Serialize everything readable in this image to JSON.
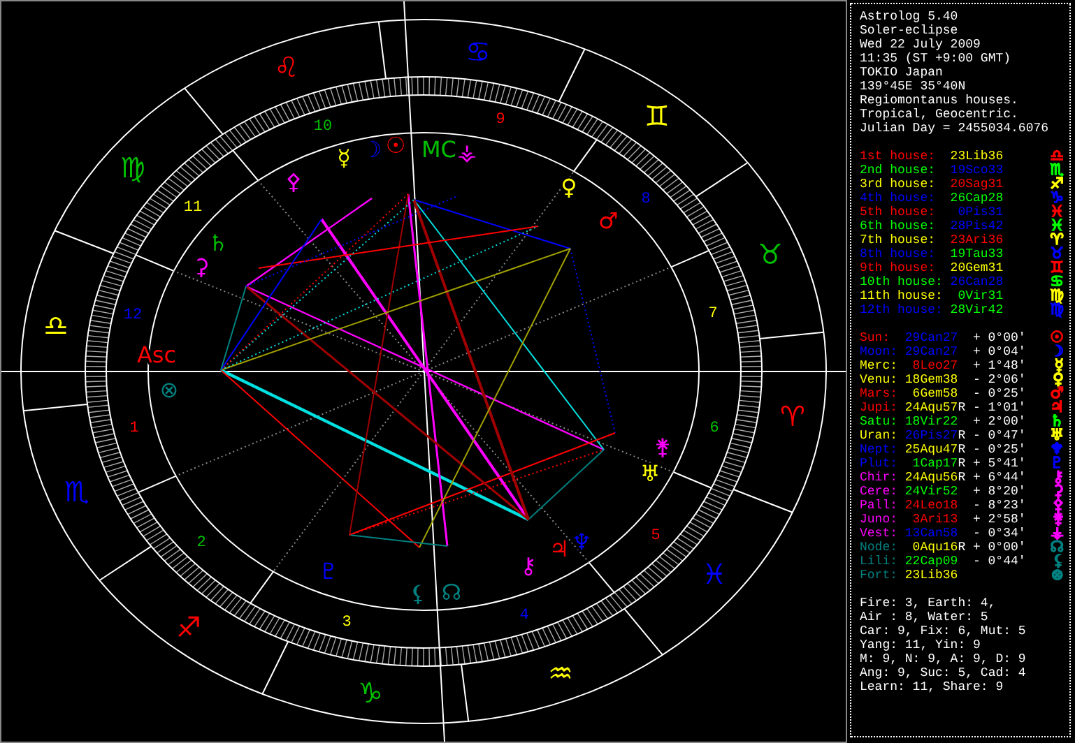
{
  "chart": {
    "signs": [
      {
        "glyph": "♎",
        "color": "#ffff00"
      },
      {
        "glyph": "♏",
        "color": "#0000ff"
      },
      {
        "glyph": "♐",
        "color": "#ff0000"
      },
      {
        "glyph": "♑",
        "color": "#00c000"
      },
      {
        "glyph": "♒",
        "color": "#ffff00"
      },
      {
        "glyph": "♓",
        "color": "#0000ff"
      },
      {
        "glyph": "♈",
        "color": "#ff0000"
      },
      {
        "glyph": "♉",
        "color": "#00c000"
      },
      {
        "glyph": "♊",
        "color": "#ffff00"
      },
      {
        "glyph": "♋",
        "color": "#0000ff"
      },
      {
        "glyph": "♌",
        "color": "#ff0000"
      },
      {
        "glyph": "♍",
        "color": "#00c000"
      }
    ],
    "house_numbers": [
      {
        "text": "1",
        "color": "#ff0000"
      },
      {
        "text": "2",
        "color": "#00c000"
      },
      {
        "text": "3",
        "color": "#ffff00"
      },
      {
        "text": "4",
        "color": "#0000ff"
      },
      {
        "text": "5",
        "color": "#ff0000"
      },
      {
        "text": "6",
        "color": "#00c000"
      },
      {
        "text": "7",
        "color": "#ffff00"
      },
      {
        "text": "8",
        "color": "#0000ff"
      },
      {
        "text": "9",
        "color": "#ff0000"
      },
      {
        "text": "10",
        "color": "#00c000"
      },
      {
        "text": "11",
        "color": "#ffff00"
      },
      {
        "text": "12",
        "color": "#0000ff"
      }
    ],
    "points": [
      {
        "glyph": "☿",
        "color": "#ffff00"
      },
      {
        "glyph": "☽",
        "color": "#0000ff"
      },
      {
        "glyph": "☉",
        "color": "#ff0000"
      },
      {
        "glyph": "MC",
        "color": "#00c000"
      },
      {
        "glyph": "⚶",
        "color": "#ff00ff"
      },
      {
        "glyph": "⚴",
        "color": "#ff00ff"
      },
      {
        "glyph": "♀",
        "color": "#ffff00"
      },
      {
        "glyph": "♂",
        "color": "#ff0000"
      },
      {
        "glyph": "♄",
        "color": "#00c000"
      },
      {
        "glyph": "⚳",
        "color": "#ff00ff"
      },
      {
        "glyph": "Asc",
        "color": "#ff0000"
      },
      {
        "glyph": "⊗",
        "color": "#008080"
      },
      {
        "glyph": "⚵",
        "color": "#ff00ff"
      },
      {
        "glyph": "♅",
        "color": "#ffff00"
      },
      {
        "glyph": "♆",
        "color": "#0000ff"
      },
      {
        "glyph": "♃",
        "color": "#ff0000"
      },
      {
        "glyph": "⚷",
        "color": "#ff00ff"
      },
      {
        "glyph": "☊",
        "color": "#008080"
      },
      {
        "glyph": "⚸",
        "color": "#008080"
      },
      {
        "glyph": "♇",
        "color": "#0000ff"
      }
    ]
  },
  "info": [
    "Astrolog 5.40",
    "Soler-eclipse",
    "Wed 22 July 2009",
    "11:35 (ST +9:00 GMT)",
    "TOKIO Japan",
    "139°45E 35°40N",
    "Regiomontanus houses.",
    "Tropical, Geocentric.",
    "Julian Day = 2455034.6076"
  ],
  "houses": [
    {
      "label": {
        "text": "1st house:",
        "color": "#ff0000"
      },
      "cusp": {
        "text": "23Lib36",
        "color": "#ffff00"
      },
      "glyph": {
        "text": "♎",
        "color": "#ff0000"
      }
    },
    {
      "label": {
        "text": "2nd house:",
        "color": "#00ff00"
      },
      "cusp": {
        "text": "19Sco33",
        "color": "#0000ff"
      },
      "glyph": {
        "text": "♏",
        "color": "#00ff00"
      }
    },
    {
      "label": {
        "text": "3rd house:",
        "color": "#ffff00"
      },
      "cusp": {
        "text": "20Sag31",
        "color": "#ff0000"
      },
      "glyph": {
        "text": "♐",
        "color": "#ffff00"
      }
    },
    {
      "label": {
        "text": "4th house:",
        "color": "#0000ff"
      },
      "cusp": {
        "text": "26Cap28",
        "color": "#00ff00"
      },
      "glyph": {
        "text": "♑",
        "color": "#0000ff"
      }
    },
    {
      "label": {
        "text": "5th house:",
        "color": "#ff0000"
      },
      "cusp": {
        "text": "0Pis31",
        "color": "#0000ff"
      },
      "glyph": {
        "text": "♓",
        "color": "#ff0000"
      }
    },
    {
      "label": {
        "text": "6th house:",
        "color": "#00ff00"
      },
      "cusp": {
        "text": "28Pis42",
        "color": "#0000ff"
      },
      "glyph": {
        "text": "♓",
        "color": "#00ff00"
      }
    },
    {
      "label": {
        "text": "7th house:",
        "color": "#ffff00"
      },
      "cusp": {
        "text": "23Ari36",
        "color": "#ff0000"
      },
      "glyph": {
        "text": "♈",
        "color": "#ffff00"
      }
    },
    {
      "label": {
        "text": "8th house:",
        "color": "#0000ff"
      },
      "cusp": {
        "text": "19Tau33",
        "color": "#00ff00"
      },
      "glyph": {
        "text": "♉",
        "color": "#0000ff"
      }
    },
    {
      "label": {
        "text": "9th house:",
        "color": "#ff0000"
      },
      "cusp": {
        "text": "20Gem31",
        "color": "#ffff00"
      },
      "glyph": {
        "text": "♊",
        "color": "#ff0000"
      }
    },
    {
      "label": {
        "text": "10th house:",
        "color": "#00ff00"
      },
      "cusp": {
        "text": "26Can28",
        "color": "#0000ff"
      },
      "glyph": {
        "text": "♋",
        "color": "#00ff00"
      }
    },
    {
      "label": {
        "text": "11th house:",
        "color": "#ffff00"
      },
      "cusp": {
        "text": "0Vir31",
        "color": "#00ff00"
      },
      "glyph": {
        "text": "♍",
        "color": "#ffff00"
      }
    },
    {
      "label": {
        "text": "12th house:",
        "color": "#0000ff"
      },
      "cusp": {
        "text": "28Vir42",
        "color": "#00ff00"
      },
      "glyph": {
        "text": "♍",
        "color": "#0000ff"
      }
    }
  ],
  "planets": [
    {
      "name": {
        "text": "Sun:",
        "color": "#ff0000"
      },
      "position": {
        "text": "29Can27",
        "color": "#0000ff"
      },
      "orb": "+ 0°00'",
      "glyph": {
        "text": "☉",
        "color": "#ff0000"
      }
    },
    {
      "name": {
        "text": "Moon:",
        "color": "#0000ff"
      },
      "position": {
        "text": "29Can27",
        "color": "#0000ff"
      },
      "orb": "+ 0°04'",
      "glyph": {
        "text": "☽",
        "color": "#0000ff"
      }
    },
    {
      "name": {
        "text": "Merc:",
        "color": "#ffff00"
      },
      "position": {
        "text": "8Leo27",
        "color": "#ff0000"
      },
      "orb": "+ 1°48'",
      "glyph": {
        "text": "☿",
        "color": "#ffff00"
      }
    },
    {
      "name": {
        "text": "Venu:",
        "color": "#ffff00"
      },
      "position": {
        "text": "18Gem38",
        "color": "#ffff00"
      },
      "orb": "- 2°06'",
      "glyph": {
        "text": "♀",
        "color": "#ffff00"
      }
    },
    {
      "name": {
        "text": "Mars:",
        "color": "#ff0000"
      },
      "position": {
        "text": "6Gem58",
        "color": "#ffff00"
      },
      "orb": "- 0°25'",
      "glyph": {
        "text": "♂",
        "color": "#ff0000"
      }
    },
    {
      "name": {
        "text": "Jupi:",
        "color": "#ff0000"
      },
      "position": {
        "text": "24Aqu57",
        "color": "#ffff00"
      },
      "retro": "R",
      "orb": "- 1°01'",
      "glyph": {
        "text": "♃",
        "color": "#ff0000"
      }
    },
    {
      "name": {
        "text": "Satu:",
        "color": "#00ff00"
      },
      "position": {
        "text": "18Vir22",
        "color": "#00ff00"
      },
      "orb": "+ 2°00'",
      "glyph": {
        "text": "♄",
        "color": "#00ff00"
      }
    },
    {
      "name": {
        "text": "Uran:",
        "color": "#ffff00"
      },
      "position": {
        "text": "26Pis27",
        "color": "#0000ff"
      },
      "retro": "R",
      "orb": "- 0°47'",
      "glyph": {
        "text": "♅",
        "color": "#ffff00"
      }
    },
    {
      "name": {
        "text": "Nept:",
        "color": "#0000ff"
      },
      "position": {
        "text": "25Aqu47",
        "color": "#ffff00"
      },
      "retro": "R",
      "orb": "- 0°25'",
      "glyph": {
        "text": "♆",
        "color": "#0000ff"
      }
    },
    {
      "name": {
        "text": "Plut:",
        "color": "#0000ff"
      },
      "position": {
        "text": "1Cap17",
        "color": "#00ff00"
      },
      "retro": "R",
      "orb": "+ 5°41'",
      "glyph": {
        "text": "♇",
        "color": "#0000ff"
      }
    },
    {
      "name": {
        "text": "Chir:",
        "color": "#ff00ff"
      },
      "position": {
        "text": "24Aqu56",
        "color": "#ffff00"
      },
      "retro": "R",
      "orb": "+ 6°44'",
      "glyph": {
        "text": "⚷",
        "color": "#ff00ff"
      }
    },
    {
      "name": {
        "text": "Cere:",
        "color": "#ff00ff"
      },
      "position": {
        "text": "24Vir52",
        "color": "#00ff00"
      },
      "orb": "+ 8°20'",
      "glyph": {
        "text": "⚳",
        "color": "#ff00ff"
      }
    },
    {
      "name": {
        "text": "Pall:",
        "color": "#ff00ff"
      },
      "position": {
        "text": "24Leo18",
        "color": "#ff0000"
      },
      "orb": "- 8°23'",
      "glyph": {
        "text": "⚴",
        "color": "#ff00ff"
      }
    },
    {
      "name": {
        "text": "Juno:",
        "color": "#ff00ff"
      },
      "position": {
        "text": "3Ari13",
        "color": "#ff0000"
      },
      "orb": "+ 2°58'",
      "glyph": {
        "text": "⚵",
        "color": "#ff00ff"
      }
    },
    {
      "name": {
        "text": "Vest:",
        "color": "#ff00ff"
      },
      "position": {
        "text": "13Can58",
        "color": "#0000ff"
      },
      "orb": "- 0°34'",
      "glyph": {
        "text": "⚶",
        "color": "#ff00ff"
      }
    },
    {
      "name": {
        "text": "Node:",
        "color": "#008080"
      },
      "position": {
        "text": "0Aqu16",
        "color": "#ffff00"
      },
      "retro": "R",
      "orb": "+ 0°00'",
      "glyph": {
        "text": "☊",
        "color": "#008080"
      }
    },
    {
      "name": {
        "text": "Lili:",
        "color": "#008080"
      },
      "position": {
        "text": "22Cap09",
        "color": "#00ff00"
      },
      "orb": "- 0°44'",
      "glyph": {
        "text": "⚸",
        "color": "#008080"
      }
    },
    {
      "name": {
        "text": "Fort:",
        "color": "#008080"
      },
      "position": {
        "text": "23Lib36",
        "color": "#ffff00"
      },
      "glyph": {
        "text": "⊗",
        "color": "#008080"
      }
    }
  ],
  "stats": [
    "Fire: 3, Earth: 4,",
    "Air : 8, Water: 5",
    "Car: 9, Fix: 6, Mut: 5",
    "Yang: 11, Yin: 9",
    "M: 9, N: 9, A: 9, D: 9",
    "Ang: 9, Suc: 5, Cad: 4",
    "Learn: 11, Share: 9"
  ]
}
